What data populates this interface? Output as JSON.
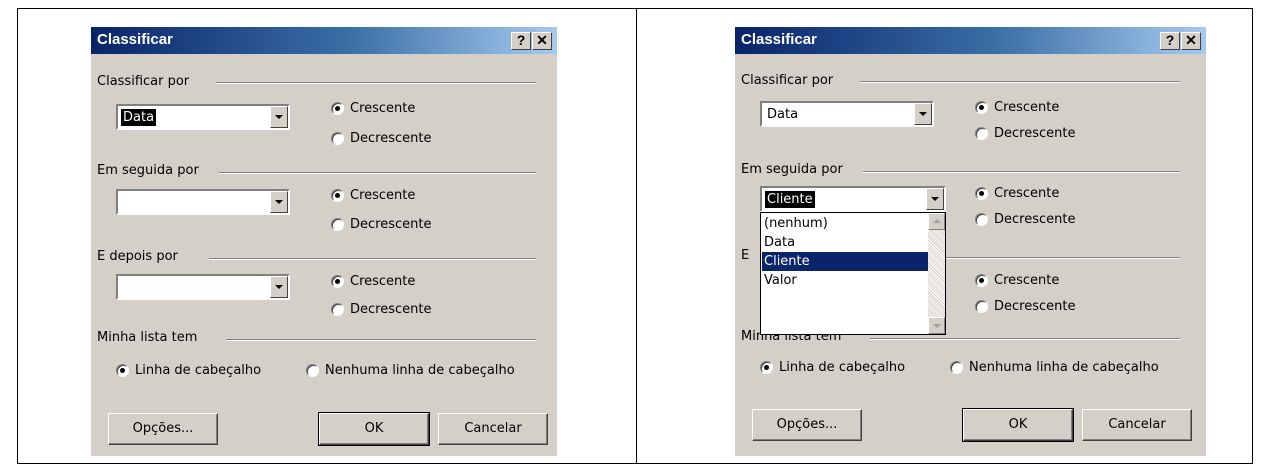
{
  "dialog_left": {
    "title": "Classificar",
    "help_button": "?",
    "close_button": "✕",
    "sort_by": {
      "label": "Classificar por",
      "value": "Data",
      "asc": "Crescente",
      "desc": "Decrescente"
    },
    "then_by": {
      "label": "Em seguida por",
      "value": "",
      "asc": "Crescente",
      "desc": "Decrescente"
    },
    "and_then_by": {
      "label": "E depois por",
      "value": "",
      "asc": "Crescente",
      "desc": "Decrescente"
    },
    "header_row": {
      "label": "Minha lista tem",
      "with_header": "Linha de cabeçalho",
      "no_header": "Nenhuma linha de cabeçalho"
    },
    "buttons": {
      "options": "Opções...",
      "ok": "OK",
      "cancel": "Cancelar"
    }
  },
  "dialog_right": {
    "title": "Classificar",
    "help_button": "?",
    "close_button": "✕",
    "sort_by": {
      "label": "Classificar por",
      "value": "Data",
      "asc": "Crescente",
      "desc": "Decrescente"
    },
    "then_by": {
      "label": "Em seguida por",
      "value": "Cliente",
      "asc": "Crescente",
      "desc": "Decrescente"
    },
    "and_then_by": {
      "label": "E",
      "asc": "Crescente",
      "desc": "Decrescente"
    },
    "header_row": {
      "label": "Minha lista tem",
      "with_header": "Linha de cabeçalho",
      "no_header": "Nenhuma linha de cabeçalho"
    },
    "dropdown_options": [
      "(nenhum)",
      "Data",
      "Cliente",
      "Valor"
    ],
    "dropdown_highlighted": "Cliente",
    "buttons": {
      "options": "Opções...",
      "ok": "OK",
      "cancel": "Cancelar"
    }
  },
  "colors": {
    "dialog_bg": "#d4d0c8",
    "titlebar": "#0a246a",
    "selection": "#0a246a"
  },
  "icons": {
    "help": "help-icon",
    "close": "close-icon",
    "dropdown": "chevron-down-icon"
  }
}
